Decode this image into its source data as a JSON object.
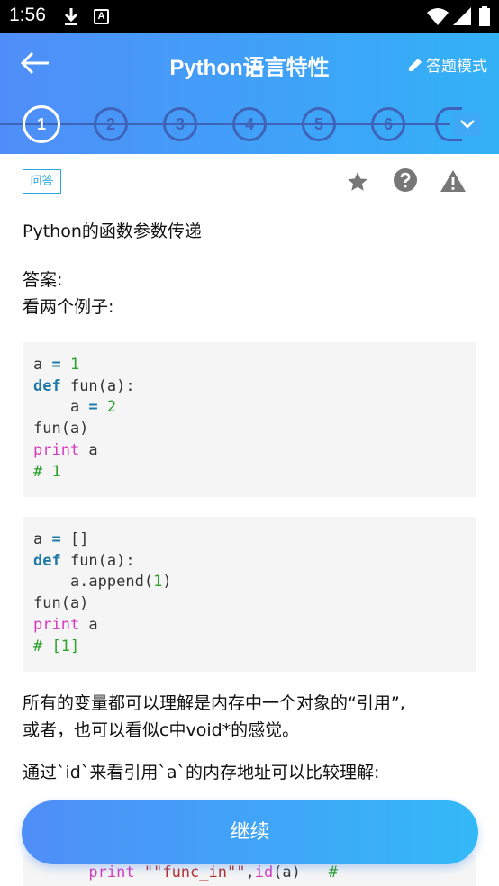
{
  "status": {
    "time": "1:56"
  },
  "header": {
    "title": "Python语言特性",
    "mode_label": "答题模式"
  },
  "steps": [
    "1",
    "2",
    "3",
    "4",
    "5",
    "6",
    "("
  ],
  "question": {
    "tag": "问答",
    "title": "Python的函数参数传递",
    "answer_label": "答案:",
    "intro": "看两个例子:"
  },
  "code1": [
    [
      "a ",
      "op:=",
      " ",
      "num:1"
    ],
    [
      "kw:def",
      " fun(a):"
    ],
    [
      "    a ",
      "op:=",
      " ",
      "num:2"
    ],
    [
      "fun(a)"
    ],
    [
      "pr:print",
      " a"
    ],
    [
      "cm:# 1"
    ]
  ],
  "code2": [
    [
      "a ",
      "op:=",
      " []"
    ],
    [
      "kw:def",
      " fun(a):"
    ],
    [
      "    a.append(",
      "num:1",
      ")"
    ],
    [
      "fun(a)"
    ],
    [
      "pr:print",
      " a"
    ],
    [
      "cm:# [1]"
    ]
  ],
  "code3": [
    [
      "      ",
      "pr:print",
      " ",
      "str:\"\"func_in\"\"",
      ",",
      "fn:id",
      "(a)   ",
      "cm:#"
    ]
  ],
  "body": {
    "p1_line1": "所有的变量都可以理解是内存中一个对象的“引用”,",
    "p1_line2": "或者，也可以看似c中void*的感觉。",
    "p2": "通过`id`来看引用`a`的内存地址可以比较理解:"
  },
  "continue_label": "继续",
  "colors": {
    "accent_start": "#4f8ef8",
    "accent_end": "#33b1f7",
    "step_inactive": "#3f63b8"
  }
}
